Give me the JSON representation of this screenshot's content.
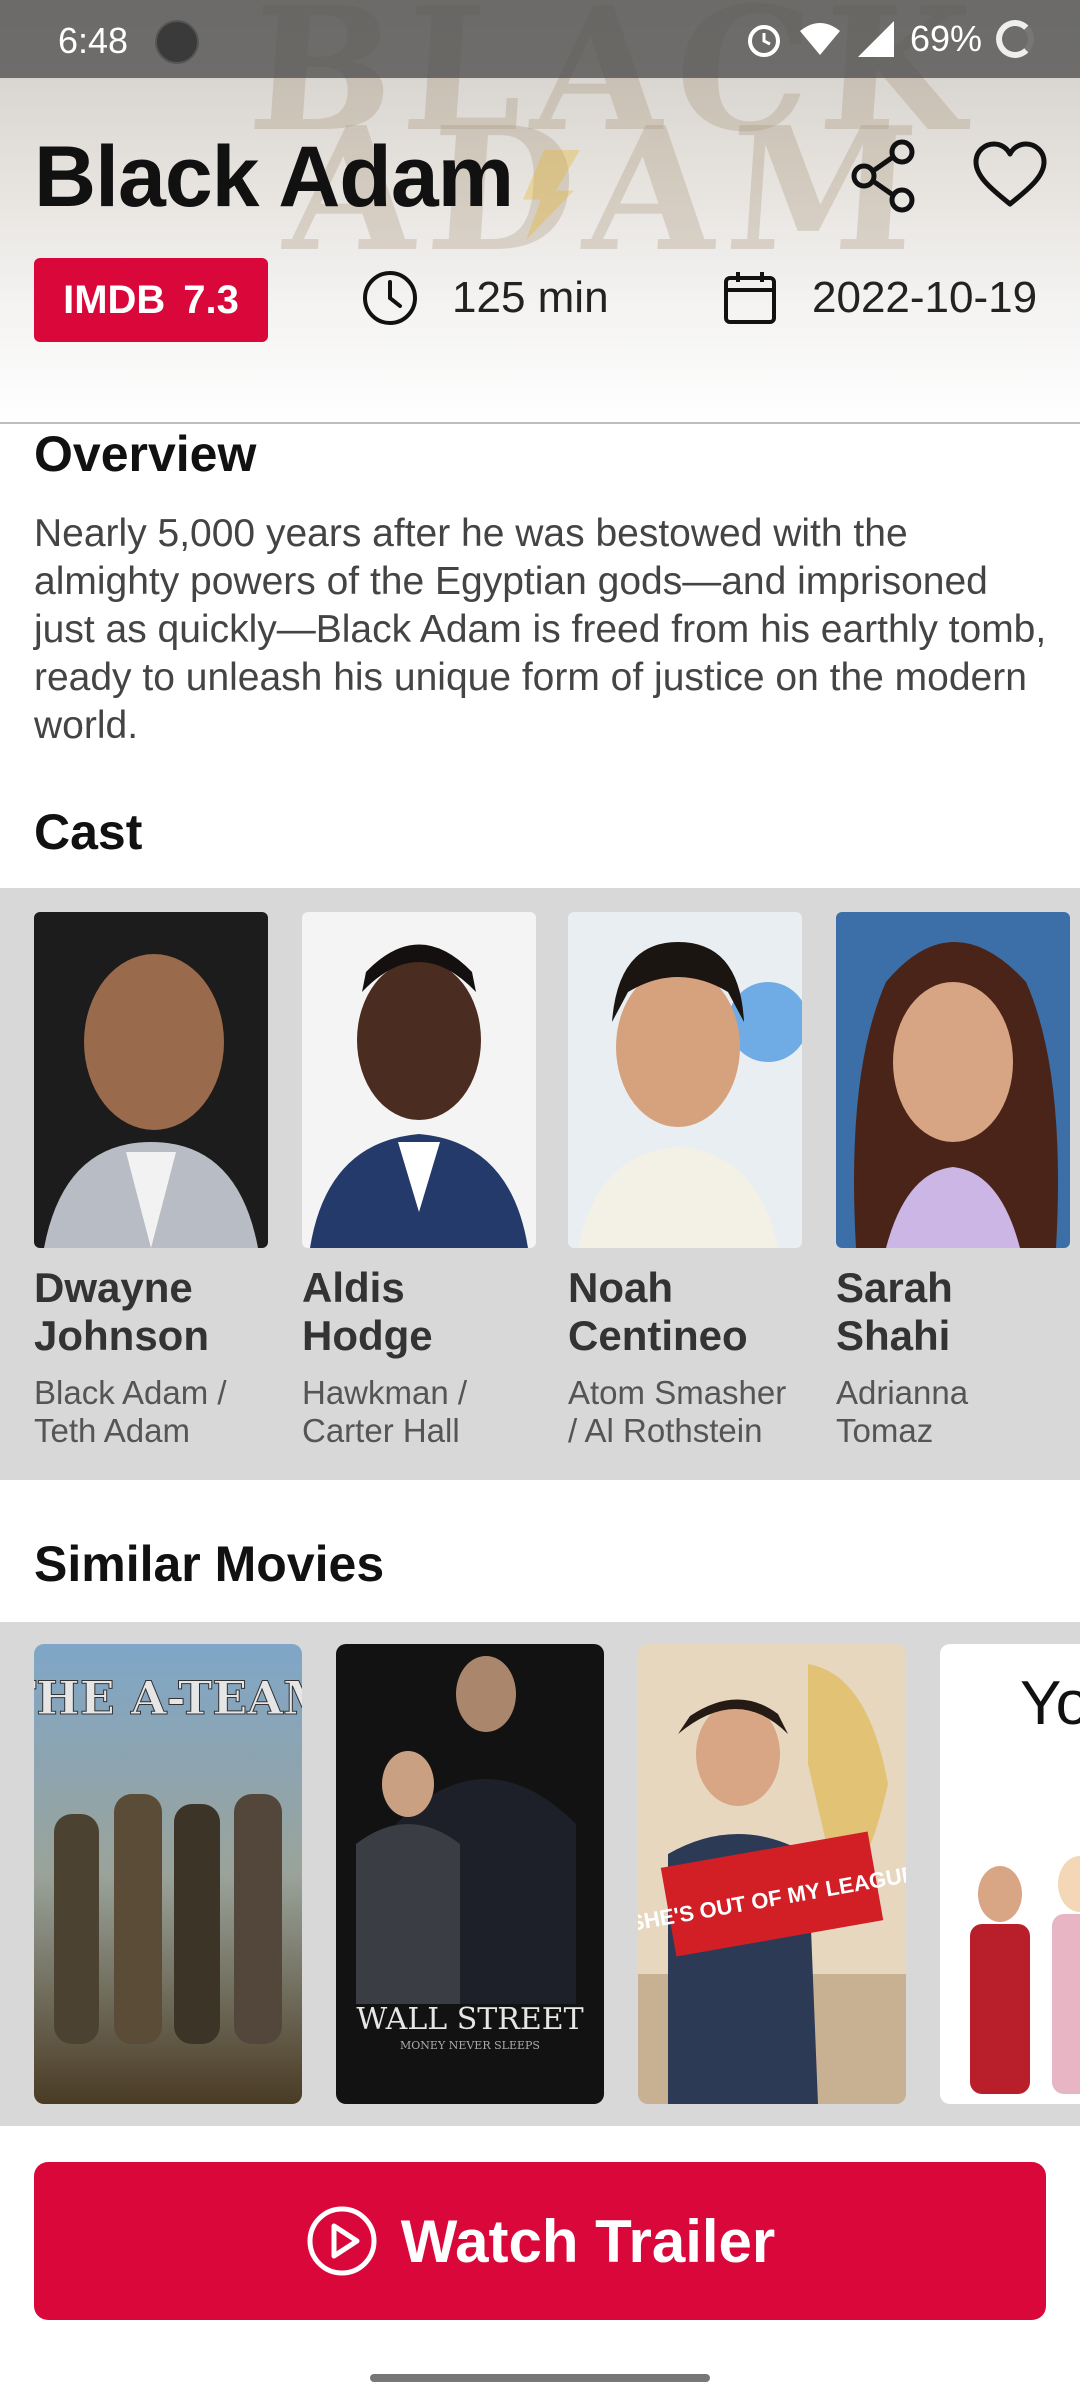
{
  "status_bar": {
    "time": "6:48",
    "battery": "69%"
  },
  "header": {
    "title": "Black Adam",
    "backdrop_text": [
      "BLACK",
      "ADAM"
    ],
    "imdb_label": "IMDB",
    "imdb_score": "7.3",
    "runtime": "125 min",
    "release_date": "2022-10-19",
    "icons": {
      "share": "share-icon",
      "favorite": "heart-icon",
      "runtime": "clock-icon",
      "release": "calendar-icon"
    }
  },
  "overview": {
    "title": "Overview",
    "text": "Nearly 5,000 years after he was bestowed with the almighty powers of the Egyptian gods—and imprisoned just as quickly—Black Adam is freed from his earthly tomb, ready to unleash his unique form of justice on the modern world."
  },
  "cast": {
    "title": "Cast",
    "members": [
      {
        "name": "Dwayne Johnson",
        "role": "Black Adam / Teth Adam"
      },
      {
        "name": "Aldis Hodge",
        "role": "Hawkman / Carter Hall"
      },
      {
        "name": "Noah Centineo",
        "role": "Atom Smasher / Al Rothstein"
      },
      {
        "name": "Sarah Shahi",
        "role": "Adrianna Tomaz"
      }
    ]
  },
  "similar": {
    "title": "Similar Movies",
    "posters": [
      {
        "text": "THE A-TEAM"
      },
      {
        "text": "WALL STREET",
        "subtext": "MONEY NEVER SLEEPS"
      },
      {
        "text": "SHE'S OUT OF MY LEAGUE"
      },
      {
        "text": "Yo Aga"
      }
    ]
  },
  "trailer_button": {
    "label": "Watch Trailer",
    "icon": "play-circle-icon"
  },
  "colors": {
    "accent": "#d9073a",
    "strip_bg": "#d8d8d8"
  }
}
